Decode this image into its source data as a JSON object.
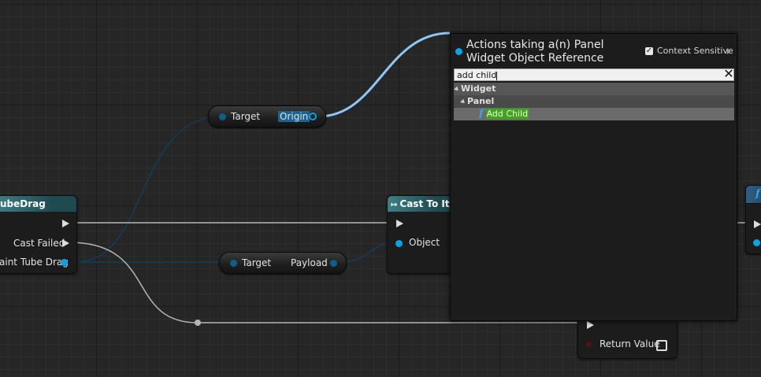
{
  "nodes": {
    "tube_drag": {
      "title": "ubeDrag",
      "cast_failed_label": "Cast Failed",
      "as_label": "aint Tube Drag"
    },
    "get_origin": {
      "target_label": "Target",
      "origin_label": "Origin"
    },
    "get_payload": {
      "target_label": "Target",
      "payload_label": "Payload"
    },
    "cast_to": {
      "title": "Cast To It",
      "object_label": "Object"
    },
    "function_node": {
      "return_value_label": "Return Value"
    }
  },
  "action_menu": {
    "title": "Actions taking a(n) Panel Widget Object Reference",
    "context_sensitive_label": "Context Sensitive",
    "context_sensitive_checked": true,
    "search_value": "add child",
    "clear_glyph": "✕",
    "tree": [
      {
        "label": "Widget",
        "level": 0,
        "expanded": true
      },
      {
        "label": "Panel",
        "level": 1,
        "expanded": true
      },
      {
        "label": "Add Child",
        "level": 2,
        "selected": true,
        "icon": "function-icon"
      }
    ]
  },
  "colors": {
    "object_pin": "#0aa2e6",
    "exec_wire": "#b9b9b9",
    "highlight_match": "#3fa51a",
    "active_wire": "#8ec6f5"
  }
}
